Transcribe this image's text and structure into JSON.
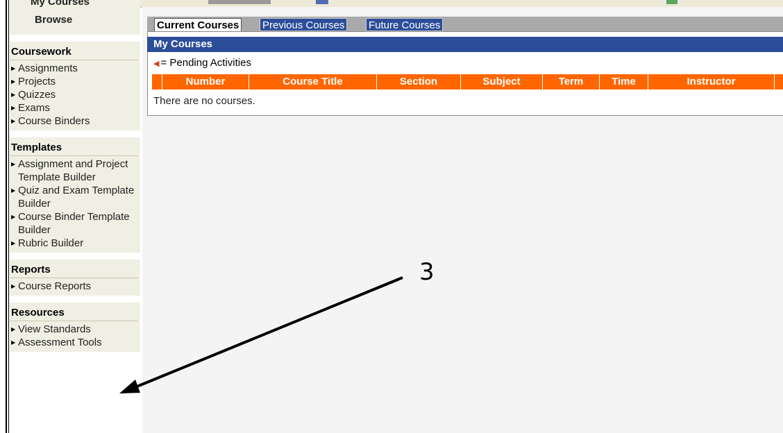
{
  "sidebar": {
    "top": {
      "my_courses": "My Courses",
      "browse": "Browse"
    },
    "groups": [
      {
        "title": "Coursework",
        "items": [
          {
            "label": "Assignments"
          },
          {
            "label": "Projects"
          },
          {
            "label": "Quizzes"
          },
          {
            "label": "Exams"
          },
          {
            "label": "Course Binders"
          }
        ]
      },
      {
        "title": "Templates",
        "items": [
          {
            "label": "Assignment and Project Template Builder"
          },
          {
            "label": "Quiz and Exam Template Builder"
          },
          {
            "label": "Course Binder Template Builder"
          },
          {
            "label": "Rubric Builder"
          }
        ]
      },
      {
        "title": "Reports",
        "items": [
          {
            "label": "Course Reports"
          }
        ]
      },
      {
        "title": "Resources",
        "items": [
          {
            "label": "View Standards"
          },
          {
            "label": "Assessment Tools"
          }
        ]
      }
    ]
  },
  "tabs": [
    {
      "label": "Current Courses"
    },
    {
      "label": "Previous Courses"
    },
    {
      "label": "Future Courses"
    }
  ],
  "panel": {
    "title": "My Courses",
    "legend": "= Pending Activities",
    "columns": [
      "",
      "Number",
      "Course Title",
      "Section",
      "Subject",
      "Term",
      "Time",
      "Instructor",
      ""
    ],
    "empty_message": "There are no courses."
  },
  "annotation": {
    "number": "3"
  },
  "colors": {
    "header_blue": "#2c4d99",
    "table_orange": "#ff6600",
    "sidebar_bg": "#f0efe3"
  }
}
